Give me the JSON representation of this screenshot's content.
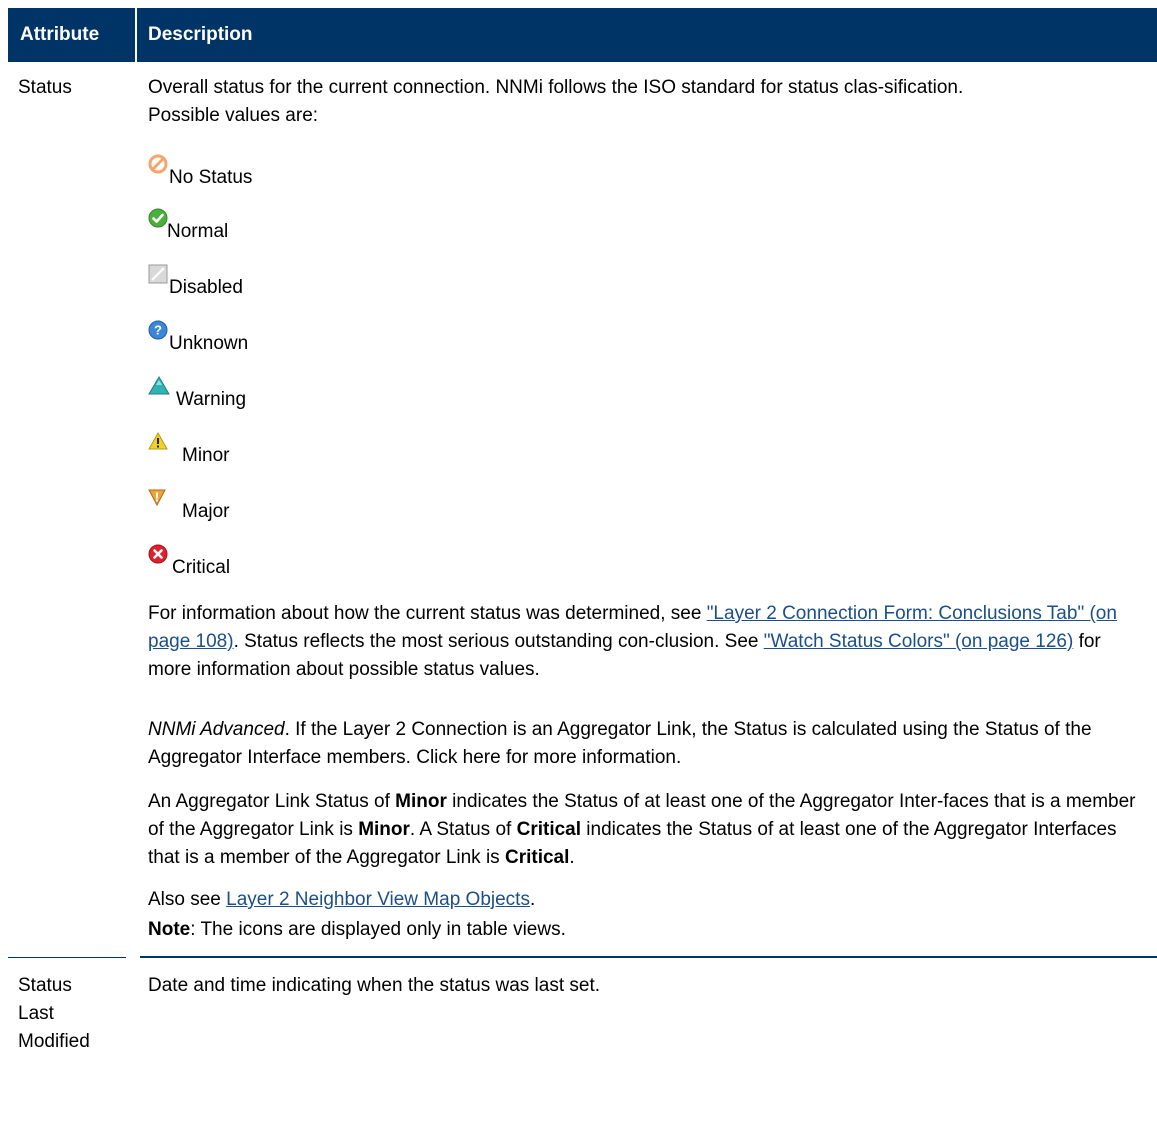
{
  "header": {
    "attribute": "Attribute",
    "description": "Description"
  },
  "rows": [
    {
      "attribute": "Status",
      "intro": "Overall status for the current connection. NNMi follows the ISO standard for status clas-sification. Possible values are:",
      "statuses": [
        {
          "label": "No Status",
          "icon": "no-status-icon",
          "color": "#f5a46b"
        },
        {
          "label": "Normal",
          "icon": "normal-icon",
          "color": "#4cae3c"
        },
        {
          "label": "Disabled",
          "icon": "disabled-icon",
          "color": "#b5b5b5"
        },
        {
          "label": "Unknown",
          "icon": "unknown-icon",
          "color": "#3c86d6"
        },
        {
          "label": "Warning",
          "icon": "warning-icon",
          "color": "#32b3b3"
        },
        {
          "label": "Minor",
          "icon": "minor-icon",
          "color": "#f2d02a"
        },
        {
          "label": "Major",
          "icon": "major-icon",
          "color": "#f0a23c"
        },
        {
          "label": "Critical",
          "icon": "critical-icon",
          "color": "#e0202c"
        }
      ],
      "para1": {
        "pre": "For information about how the current status was determined, see ",
        "link1": "\"Layer 2 Connection Form: Conclusions Tab\" (on page 108)",
        "mid": ". Status reflects the most serious outstanding con-clusion. See ",
        "link2": "\"Watch Status Colors\" (on page 126)",
        "post": " for more information about possible status values."
      },
      "para2": {
        "italic": "NNMi Advanced",
        "text": ". If the Layer 2 Connection is an Aggregator Link, the Status is calculated using the Status of the Aggregator Interface members. Click here for more information."
      },
      "para3": {
        "t1": "An Aggregator Link Status of ",
        "b1": "Minor",
        "t2": " indicates the Status of at least one of the Aggregator Inter-faces that is a member of the Aggregator Link is ",
        "b2": "Minor",
        "t3": ". A Status of ",
        "b3": "Critical",
        "t4": " indicates the Status of at least one of the Aggregator Interfaces that is a member of the Aggregator Link is ",
        "b4": "Critical",
        "t5": "."
      },
      "para4": {
        "pre": "Also see ",
        "link": "Layer 2 Neighbor View Map Objects",
        "post": "."
      },
      "para5": {
        "bold": "Note",
        "text": ": The icons are displayed only in table views."
      }
    },
    {
      "attribute_lines": [
        "Status",
        "Last",
        "Modified"
      ],
      "description": "Date and time indicating when the status was last set."
    }
  ],
  "colors": {
    "header_bg": "#003466",
    "link": "#1a4f8a"
  }
}
